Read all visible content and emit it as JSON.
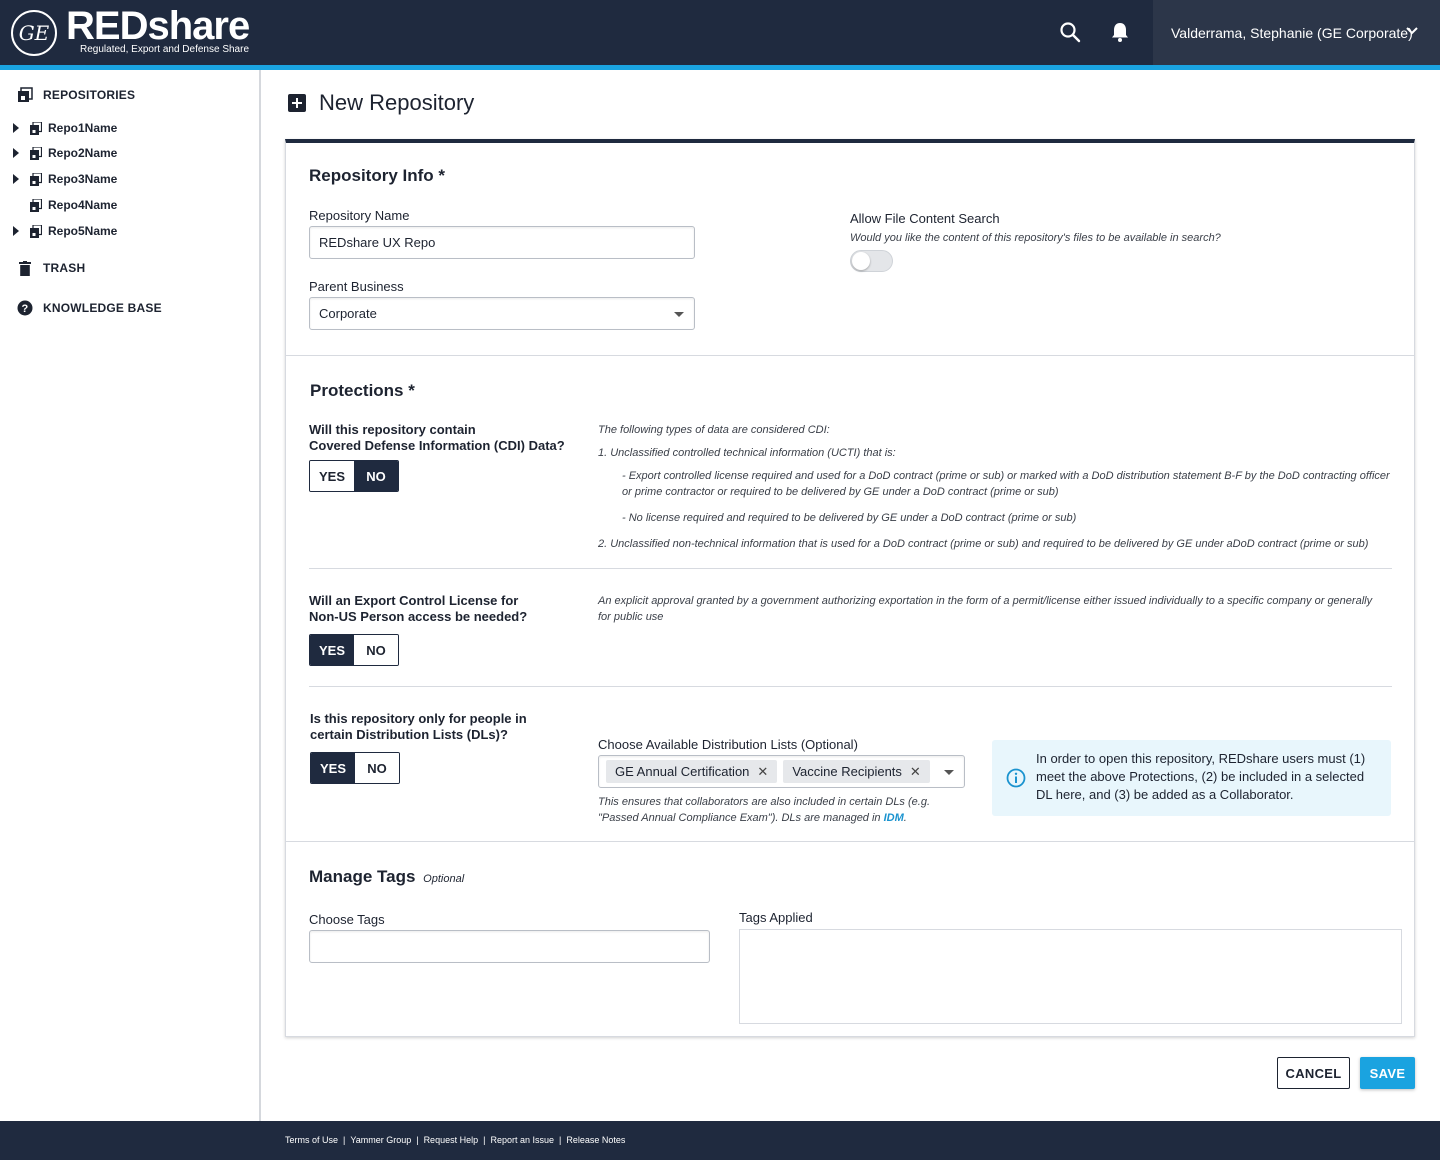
{
  "header": {
    "logo_text": "GE",
    "brand": "REDshare",
    "brand_subtitle": "Regulated, Export and Defense Share",
    "user_name": "Valderrama, Stephanie (GE Corporate)",
    "icons": [
      "search-icon",
      "bell-icon",
      "chevron-down-icon"
    ],
    "accent_color": "#1aa3e0",
    "bar_color": "#1f2a3f"
  },
  "sidebar": {
    "repositories_label": "REPOSITORIES",
    "repos": [
      {
        "label": "Repo1Name",
        "expandable": true
      },
      {
        "label": "Repo2Name",
        "expandable": true
      },
      {
        "label": "Repo3Name",
        "expandable": true
      },
      {
        "label": "Repo4Name",
        "expandable": false
      },
      {
        "label": "Repo5Name",
        "expandable": true
      }
    ],
    "trash_label": "TRASH",
    "kb_label": "KNOWLEDGE BASE"
  },
  "page": {
    "title": "New Repository"
  },
  "repo_info": {
    "heading": "Repository Info *",
    "name_label": "Repository Name",
    "name_value": "REDshare UX Repo",
    "parent_label": "Parent Business",
    "parent_value": "Corporate",
    "search_label": "Allow File Content Search",
    "search_hint": "Would you like the content of this repository's files to be available in search?",
    "search_enabled": false
  },
  "protections": {
    "heading": "Protections *",
    "cdi": {
      "question_line1": "Will this repository contain",
      "question_line2": "Covered Defense Information (CDI) Data?",
      "yes": "YES",
      "no": "NO",
      "selected": "NO",
      "desc_intro": "The following types of data are considered CDI:",
      "desc_1": "1. Unclassified controlled technical information (UCTI) that is:",
      "desc_1a_line1": "- Export controlled license required and used for a DoD contract (prime or sub) or marked with a DoD distribution statement B-F by the DoD contracting officer",
      "desc_1a_line2": "or prime contractor or required to be delivered by GE under a DoD contract (prime or sub)",
      "desc_1b": "- No license required and required to be delivered by GE under a DoD contract (prime or sub)",
      "desc_2": "2. Unclassified non-technical information that is used for a DoD contract (prime or sub) and required to be delivered by GE under aDoD contract (prime or sub)"
    },
    "export": {
      "question_line1": "Will an Export Control License for",
      "question_line2": "Non-US Person access be needed?",
      "yes": "YES",
      "no": "NO",
      "selected": "YES",
      "desc_line1": "An explicit approval granted by a government authorizing exportation in the form of a permit/license either issued individually to a specific company or generally",
      "desc_line2": "for public use"
    },
    "dl": {
      "question_line1": "Is this repository only for people in",
      "question_line2": "certain Distribution Lists (DLs)?",
      "yes": "YES",
      "no": "NO",
      "selected": "YES",
      "choose_label": "Choose Available Distribution Lists (Optional)",
      "chips": [
        "GE Annual Certification",
        "Vaccine Recipients"
      ],
      "hint_line1": "This ensures that collaborators are also included in certain DLs (e.g.",
      "hint_line2_pre": "\"Passed Annual Compliance Exam\"). DLs are managed in ",
      "hint_link": "IDM",
      "hint_end": ".",
      "info_text": "In order to open this repository, REDshare users must (1) meet the above Protections, (2) be included in a selected DL here, and (3) be added as a Collaborator."
    }
  },
  "tags": {
    "heading": "Manage Tags",
    "optional": "Optional",
    "choose_label": "Choose Tags",
    "choose_value": "",
    "applied_label": "Tags Applied"
  },
  "actions": {
    "cancel": "CANCEL",
    "save": "SAVE"
  },
  "footer": {
    "links": [
      "Terms of Use",
      "Yammer Group",
      "Request Help",
      "Report an Issue",
      "Release Notes"
    ]
  }
}
